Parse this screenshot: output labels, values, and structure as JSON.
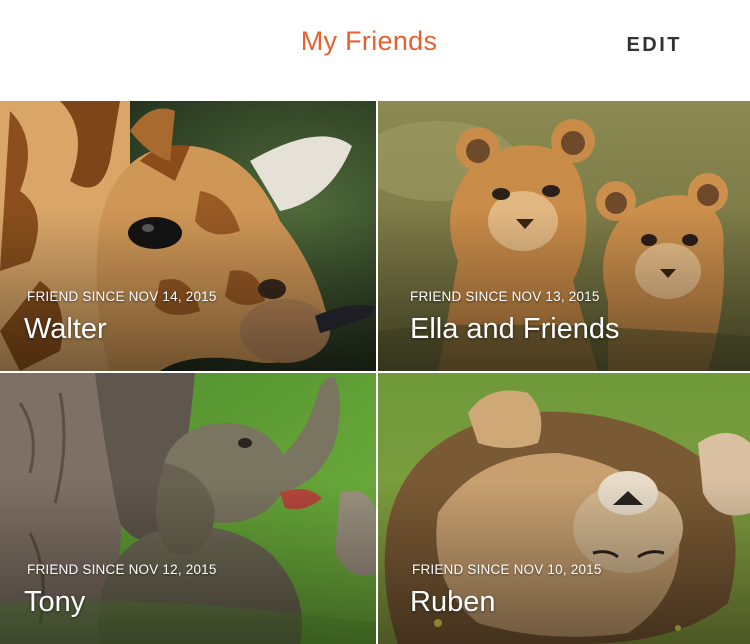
{
  "header": {
    "title": "My Friends",
    "edit_label": "EDIT"
  },
  "colors": {
    "accent": "#e8602c",
    "edit_text": "#333333",
    "background": "#ffffff",
    "overlay_text": "#ffffff"
  },
  "friends": [
    {
      "since": "FRIEND SINCE NOV 14, 2015",
      "name": "Walter",
      "image": "baby-giraffe-photo"
    },
    {
      "since": "FRIEND SINCE NOV 13, 2015",
      "name": "Ella and Friends",
      "image": "lion-cubs-photo"
    },
    {
      "since": "FRIEND SINCE NOV 12, 2015",
      "name": "Tony",
      "image": "baby-elephant-photo"
    },
    {
      "since": "FRIEND SINCE NOV 10, 2015",
      "name": "Ruben",
      "image": "lion-rolling-photo"
    }
  ]
}
